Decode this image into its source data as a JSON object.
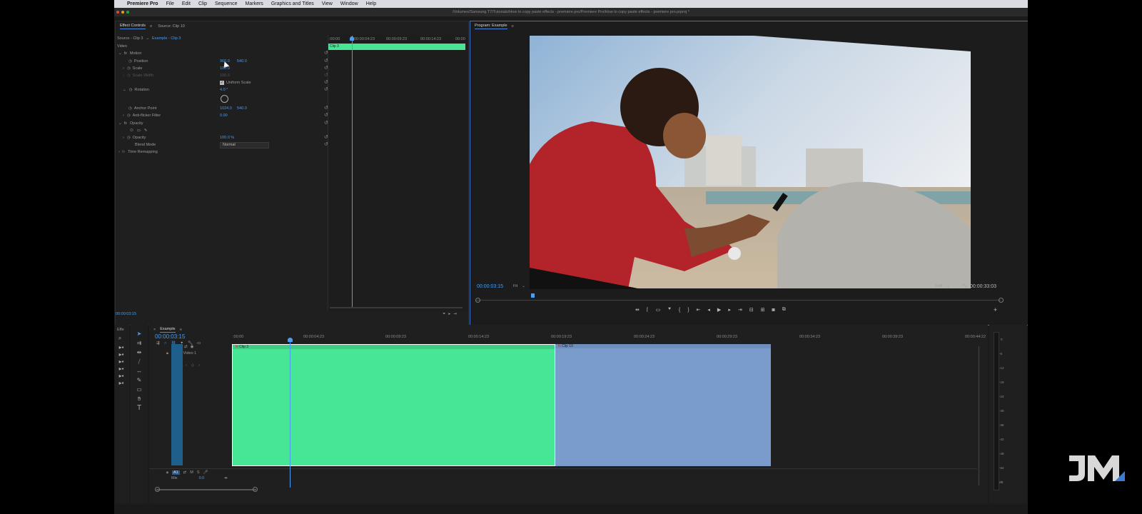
{
  "menubar": {
    "app_name": "Premiere Pro",
    "items": [
      "File",
      "Edit",
      "Clip",
      "Sequence",
      "Markers",
      "Graphics and Titles",
      "View",
      "Window",
      "Help"
    ]
  },
  "window": {
    "title": "/Volumes/Samsung T7/Tutorials/How to copy paste effects - premiere pro/Premiere Pro/How to copy paste effects - premiere pro.prproj *"
  },
  "effect_controls": {
    "tab_label": "Effect Controls",
    "source_tab": "Source: Clip 10",
    "source_selector": "Source - Clip 3",
    "sequence_selector": "Example - Clip 3",
    "section_video": "Video",
    "motion": "Motion",
    "position_label": "Position",
    "position_x": "960.0",
    "position_y": "540.0",
    "scale_label": "Scale",
    "scale_value": "100.0",
    "scale_width_label": "Scale Width",
    "scale_width_value": "100.0",
    "uniform_scale_label": "Uniform Scale",
    "rotation_label": "Rotation",
    "rotation_value": "4.0 °",
    "anchor_label": "Anchor Point",
    "anchor_x": "1024.0",
    "anchor_y": "540.0",
    "antiflicker_label": "Anti-flicker Filter",
    "antiflicker_value": "0.00",
    "opacity_section": "Opacity",
    "opacity_label": "Opacity",
    "opacity_value": "100.0 %",
    "blend_label": "Blend Mode",
    "blend_value": "Normal",
    "time_remap": "Time Remapping",
    "timecode": "00:00:03:15",
    "ruler": [
      ":00:00",
      "00:00:04:23",
      "00:00:09:23",
      "00:00:14:23",
      "00:00"
    ],
    "clip_label": "Clip 3",
    "fx_icon": "fx"
  },
  "program": {
    "tab_label": "Program: Example",
    "timecode": "00:00:03:15",
    "fit": "Fit",
    "quality": "Full",
    "duration": "00:00:33:03"
  },
  "timeline": {
    "tab_label": "Example",
    "timecode": "00:00:03:15",
    "ruler": [
      ":00:00",
      "00:00:04:23",
      "00:00:09:23",
      "00:00:14:23",
      "00:00:19:23",
      "00:00:24:23",
      "00:00:29:23",
      "00:00:34:23",
      "00:00:39:23",
      "00:00:44:22"
    ],
    "v1": "V1",
    "video1": "Video 1",
    "a1": "A1",
    "mix": "Mix",
    "mix_value": "0.0",
    "clip1": "Clip 3",
    "clip2": "Clip 10",
    "meter": [
      "0",
      "-6",
      "-12",
      "-18",
      "-24",
      "-30",
      "-36",
      "-42",
      "-48",
      "-54",
      "dB"
    ]
  },
  "project_panel": {
    "tab": "Effe"
  },
  "watermark": {
    "text": "JM"
  },
  "colors": {
    "accent": "#4a9df0",
    "clip_green": "#46e695",
    "clip_blue": "#7a9ccc"
  },
  "icons": [
    "apple-icon",
    "stopwatch-icon",
    "reset-icon",
    "play-icon",
    "step-back-icon",
    "step-forward-icon",
    "camera-icon",
    "wrench-icon",
    "selection-tool-icon",
    "razor-tool-icon",
    "hand-tool-icon",
    "type-tool-icon",
    "pen-tool-icon",
    "lock-icon",
    "eye-icon",
    "mic-icon"
  ]
}
